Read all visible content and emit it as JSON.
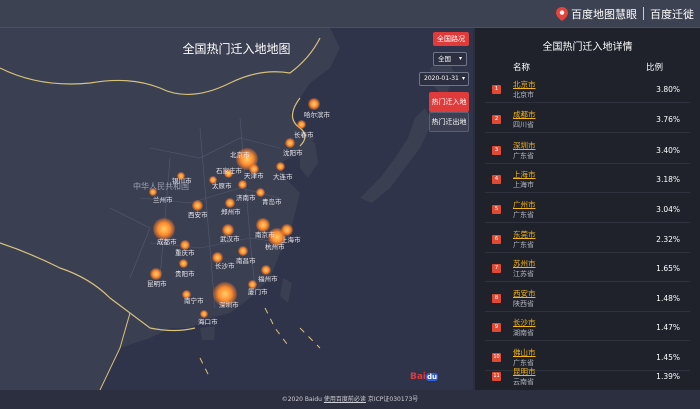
{
  "header": {
    "brand_primary": "百度地图慧眼",
    "brand_secondary": "百度迁徙"
  },
  "map": {
    "title": "全国热门迁入地地图",
    "controls": {
      "national_holiday_button": "全国路况",
      "region_select": "全国",
      "date_select": "2020-01-31",
      "hot_inbound_button": "热门迁入地",
      "hot_outbound_button": "热门迁出地"
    },
    "cities": [
      {
        "name": "哈尔滨市"
      },
      {
        "name": "长春市"
      },
      {
        "name": "沈阳市"
      },
      {
        "name": "北京市"
      },
      {
        "name": "天津市"
      },
      {
        "name": "大连市"
      },
      {
        "name": "石家庄市"
      },
      {
        "name": "太原市"
      },
      {
        "name": "济南市"
      },
      {
        "name": "青岛市"
      },
      {
        "name": "银川市"
      },
      {
        "name": "兰州市"
      },
      {
        "name": "西安市"
      },
      {
        "name": "郑州市"
      },
      {
        "name": "成都市"
      },
      {
        "name": "重庆市"
      },
      {
        "name": "武汉市"
      },
      {
        "name": "南京市"
      },
      {
        "name": "上海市"
      },
      {
        "name": "杭州市"
      },
      {
        "name": "贵阳市"
      },
      {
        "name": "长沙市"
      },
      {
        "name": "南昌市"
      },
      {
        "name": "福州市"
      },
      {
        "name": "昆明市"
      },
      {
        "name": "南宁市"
      },
      {
        "name": "深圳市"
      },
      {
        "name": "厦门市"
      },
      {
        "name": "海口市"
      }
    ],
    "region_labels": [
      "中华人民共和国"
    ]
  },
  "side": {
    "title": "全国热门迁入地详情",
    "col_name": "名称",
    "col_ratio": "比例",
    "rows": [
      {
        "rank": "1",
        "city": "北京市",
        "province": "北京市",
        "value": "3.80%"
      },
      {
        "rank": "2",
        "city": "成都市",
        "province": "四川省",
        "value": "3.76%"
      },
      {
        "rank": "3",
        "city": "深圳市",
        "province": "广东省",
        "value": "3.40%"
      },
      {
        "rank": "4",
        "city": "上海市",
        "province": "上海市",
        "value": "3.18%"
      },
      {
        "rank": "5",
        "city": "广州市",
        "province": "广东省",
        "value": "3.04%"
      },
      {
        "rank": "6",
        "city": "东莞市",
        "province": "广东省",
        "value": "2.32%"
      },
      {
        "rank": "7",
        "city": "苏州市",
        "province": "江苏省",
        "value": "1.65%"
      },
      {
        "rank": "8",
        "city": "西安市",
        "province": "陕西省",
        "value": "1.48%"
      },
      {
        "rank": "9",
        "city": "长沙市",
        "province": "湖南省",
        "value": "1.47%"
      },
      {
        "rank": "10",
        "city": "佛山市",
        "province": "广东省",
        "value": "1.45%"
      },
      {
        "rank": "11",
        "city": "昆明市",
        "province": "云南省",
        "value": "1.39%"
      }
    ]
  },
  "footer": {
    "copyright": "©2020 Baidu",
    "terms_link": "使用百度前必读",
    "icp": "京ICP证030173号"
  },
  "logo_text": "Bai du"
}
